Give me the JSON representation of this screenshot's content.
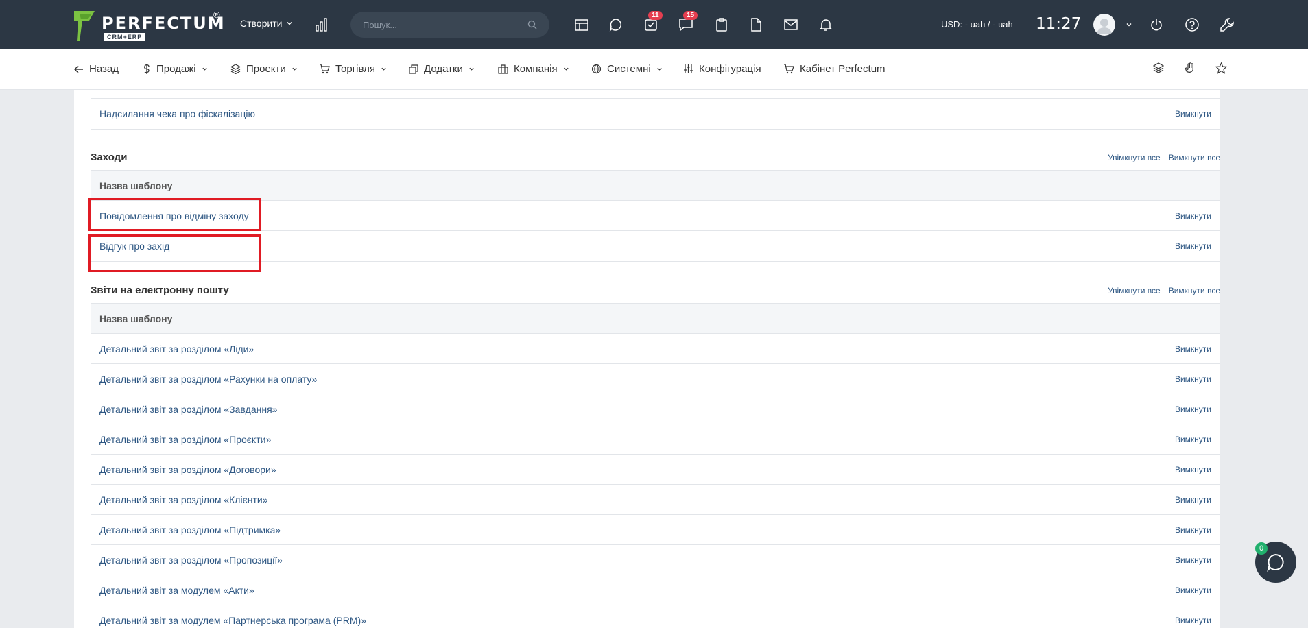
{
  "brand": {
    "name": "PERFECTUM",
    "reg": "®",
    "sub": "CRM+ERP"
  },
  "topbar": {
    "create_label": "Створити",
    "search_placeholder": "Пошук...",
    "badges": {
      "tasks": "11",
      "messages": "15"
    },
    "currency": "USD: - uah / - uah",
    "time": "11:27"
  },
  "nav": {
    "back": "Назад",
    "items": [
      "Продажі",
      "Проекти",
      "Торгівля",
      "Додатки",
      "Компанія",
      "Системні",
      "Конфігурація",
      "Кабінет Perfectum"
    ]
  },
  "sections": {
    "fiscal": {
      "rows": [
        {
          "name": "Надсилання чека про фіскалізацію",
          "toggle": "Вимкнути"
        }
      ]
    },
    "events": {
      "title": "Заходи",
      "enable_all": "Увімкнути все",
      "disable_all": "Вимкнути все",
      "header": "Назва шаблону",
      "rows": [
        {
          "name": "Повідомлення про відміну заходу",
          "toggle": "Вимкнути"
        },
        {
          "name": "Відгук про захід",
          "toggle": "Вимкнути"
        }
      ]
    },
    "reports": {
      "title": "Звіти на електронну пошту",
      "enable_all": "Увімкнути все",
      "disable_all": "Вимкнути все",
      "header": "Назва шаблону",
      "rows": [
        {
          "name": "Детальний звіт за розділом «Ліди»",
          "toggle": "Вимкнути"
        },
        {
          "name": "Детальний звіт за розділом «Рахунки на оплату»",
          "toggle": "Вимкнути"
        },
        {
          "name": "Детальний звіт за розділом «Завдання»",
          "toggle": "Вимкнути"
        },
        {
          "name": "Детальний звіт за розділом «Проєкти»",
          "toggle": "Вимкнути"
        },
        {
          "name": "Детальний звіт за розділом «Договори»",
          "toggle": "Вимкнути"
        },
        {
          "name": "Детальний звіт за розділом «Клієнти»",
          "toggle": "Вимкнути"
        },
        {
          "name": "Детальний звіт за розділом «Підтримка»",
          "toggle": "Вимкнути"
        },
        {
          "name": "Детальний звіт за розділом «Пропозиції»",
          "toggle": "Вимкнути"
        },
        {
          "name": "Детальний звіт за модулем «Акти»",
          "toggle": "Вимкнути"
        },
        {
          "name": "Детальний звіт за модулем «Партнерська програма (PRM)»",
          "toggle": "Вимкнути"
        }
      ]
    }
  },
  "chat": {
    "count": "0"
  },
  "colors": {
    "topbar": "#2c3744",
    "link": "#2e5783",
    "highlight": "#e01b24",
    "badge": "#e53e50"
  }
}
